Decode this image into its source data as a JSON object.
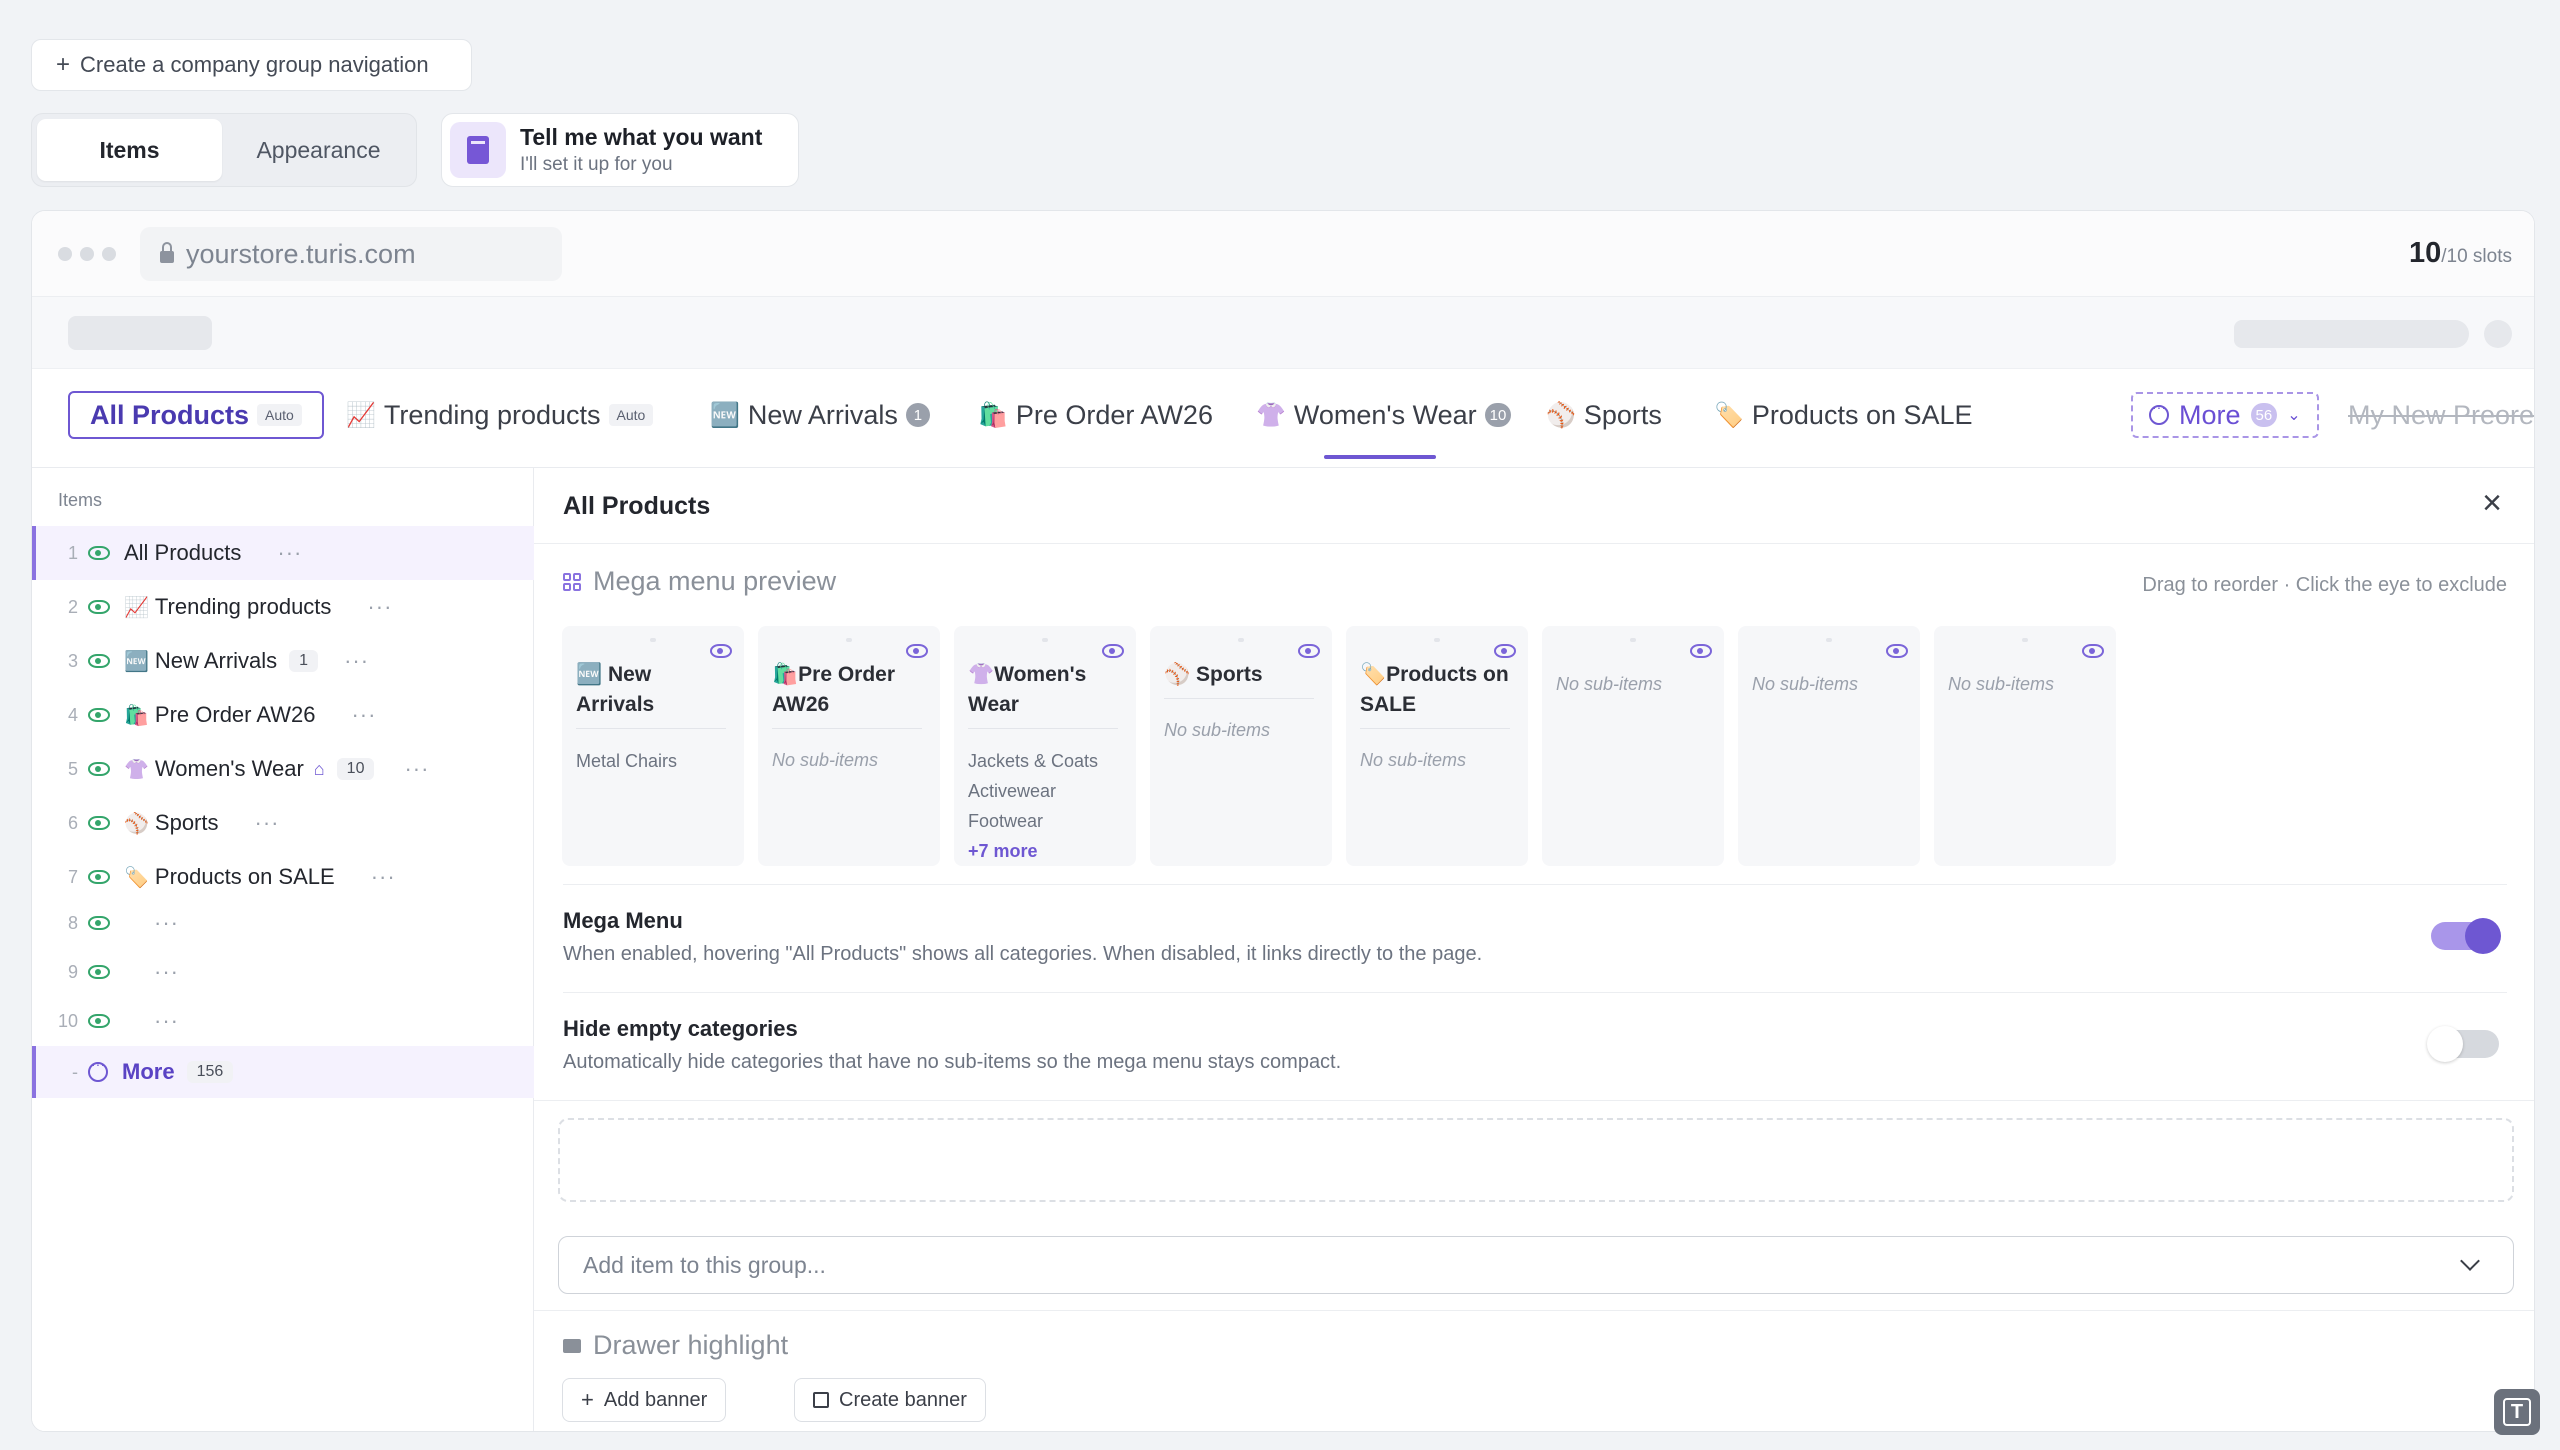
{
  "top": {
    "create_label": "Create a company group navigation",
    "seg_items": "Items",
    "seg_appearance": "Appearance",
    "assist_title": "Tell me what you want",
    "assist_sub": "I'll set it up for you"
  },
  "browser": {
    "url": "yourstore.turis.com",
    "slots_used": "10",
    "slots_total": "/10 slots"
  },
  "nav": {
    "tabs": [
      {
        "label": "All Products",
        "badge": "Auto"
      },
      {
        "label": "Trending products",
        "emoji": "📈",
        "badge": "Auto"
      },
      {
        "label": "New Arrivals",
        "emoji": "🆕",
        "count": "1"
      },
      {
        "label": "Pre Order AW26",
        "emoji": "🛍️"
      },
      {
        "label": "Women's Wear",
        "emoji": "👚",
        "count": "10"
      },
      {
        "label": "Sports",
        "emoji": "⚾"
      },
      {
        "label": "Products on SALE",
        "emoji": "🏷️"
      }
    ],
    "more_label": "More",
    "more_count": "56",
    "struck_label": "My New Preore"
  },
  "sidebar": {
    "title": "Items",
    "items": [
      {
        "num": "1",
        "label": "All Products"
      },
      {
        "num": "2",
        "emoji": "📈",
        "label": "Trending products"
      },
      {
        "num": "3",
        "emoji": "🆕",
        "label": "New Arrivals",
        "badge": "1"
      },
      {
        "num": "4",
        "emoji": "🛍️",
        "label": "Pre Order AW26"
      },
      {
        "num": "5",
        "emoji": "👚",
        "label": "Women's Wear",
        "badge": "10"
      },
      {
        "num": "6",
        "emoji": "⚾",
        "label": "Sports"
      },
      {
        "num": "7",
        "emoji": "🏷️",
        "label": "Products on SALE"
      },
      {
        "num": "8"
      },
      {
        "num": "9"
      },
      {
        "num": "10"
      }
    ],
    "more": {
      "num": "-",
      "label": "More",
      "badge": "156"
    }
  },
  "panel": {
    "title": "All Products",
    "mega_title": "Mega menu preview",
    "mega_hint": "Drag to reorder · Click the eye to exclude",
    "cards": [
      {
        "emoji": "🆕",
        "title": "New Arrivals",
        "subs": [
          "Metal Chairs"
        ]
      },
      {
        "emoji": "🛍️",
        "title": "Pre Order AW26",
        "empty": "No sub-items"
      },
      {
        "emoji": "👚",
        "title": "Women's Wear",
        "subs": [
          "Jackets & Coats",
          "Activewear",
          "Footwear"
        ],
        "more": "+7 more"
      },
      {
        "emoji": "⚾",
        "title": "Sports",
        "empty": "No sub-items"
      },
      {
        "emoji": "🏷️",
        "title": "Products on SALE",
        "empty": "No sub-items"
      },
      {
        "empty": "No sub-items"
      },
      {
        "empty": "No sub-items"
      },
      {
        "empty": "No sub-items"
      }
    ],
    "mega_menu": {
      "title": "Mega Menu",
      "desc": "When enabled, hovering \"All Products\" shows all categories. When disabled, it links directly to the page.",
      "enabled": true
    },
    "hide_empty": {
      "title": "Hide empty categories",
      "desc": "Automatically hide categories that have no sub-items so the mega menu stays compact.",
      "enabled": false
    },
    "add_placeholder": "Add item to this group...",
    "drawer_title": "Drawer highlight",
    "add_banner": "Add banner",
    "create_banner": "Create banner"
  },
  "colors": {
    "accent": "#6e57d2",
    "eye_green": "#34a56b"
  }
}
